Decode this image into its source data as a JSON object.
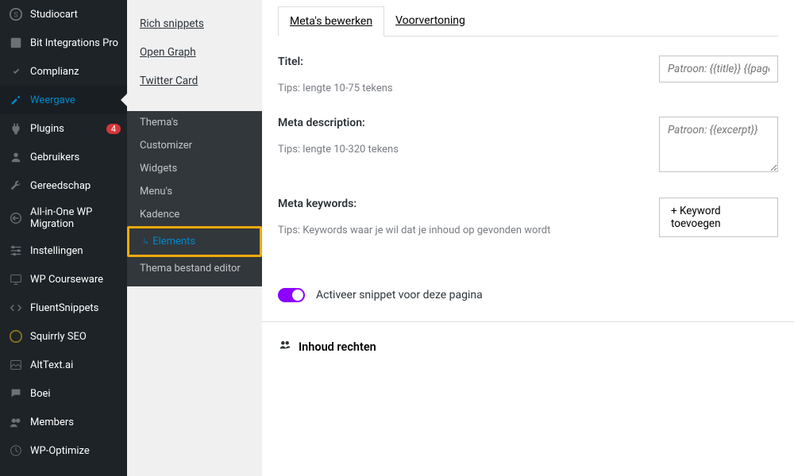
{
  "sidebar": {
    "items": [
      {
        "label": "Studiocart"
      },
      {
        "label": "Bit Integrations Pro"
      },
      {
        "label": "Complianz"
      },
      {
        "label": "Weergave"
      },
      {
        "label": "Plugins",
        "badge": "4"
      },
      {
        "label": "Gebruikers"
      },
      {
        "label": "Gereedschap"
      },
      {
        "label": "All-in-One WP Migration"
      },
      {
        "label": "Instellingen"
      },
      {
        "label": "WP Courseware"
      },
      {
        "label": "FluentSnippets"
      },
      {
        "label": "Squirrly SEO"
      },
      {
        "label": "AltText.ai"
      },
      {
        "label": "Boei"
      },
      {
        "label": "Members"
      },
      {
        "label": "WP-Optimize"
      }
    ]
  },
  "seo_sublinks": [
    "Rich snippets",
    "Open Graph",
    "Twitter Card"
  ],
  "appearance_submenu": [
    "Thema's",
    "Customizer",
    "Widgets",
    "Menu's",
    "Kadence",
    "Elements",
    "Thema bestand editor"
  ],
  "tabs": [
    {
      "label": "Meta's bewerken",
      "active": true
    },
    {
      "label": "Voorvertoning",
      "active": false
    }
  ],
  "fields": {
    "title": {
      "label": "Titel:",
      "tips": "Tips: lengte 10-75 tekens",
      "placeholder": "Patroon: {{title}} {{page}} {{se"
    },
    "description": {
      "label": "Meta description:",
      "tips": "Tips: lengte 10-320 tekens",
      "placeholder": "Patroon: {{excerpt}}"
    },
    "keywords": {
      "label": "Meta keywords:",
      "tips": "Tips: Keywords waar je wil dat je inhoud op gevonden wordt",
      "button": "+ Keyword toevoegen"
    }
  },
  "toggle": {
    "label": "Activeer snippet voor deze pagina",
    "on": true
  },
  "rights_header": "Inhoud rechten"
}
